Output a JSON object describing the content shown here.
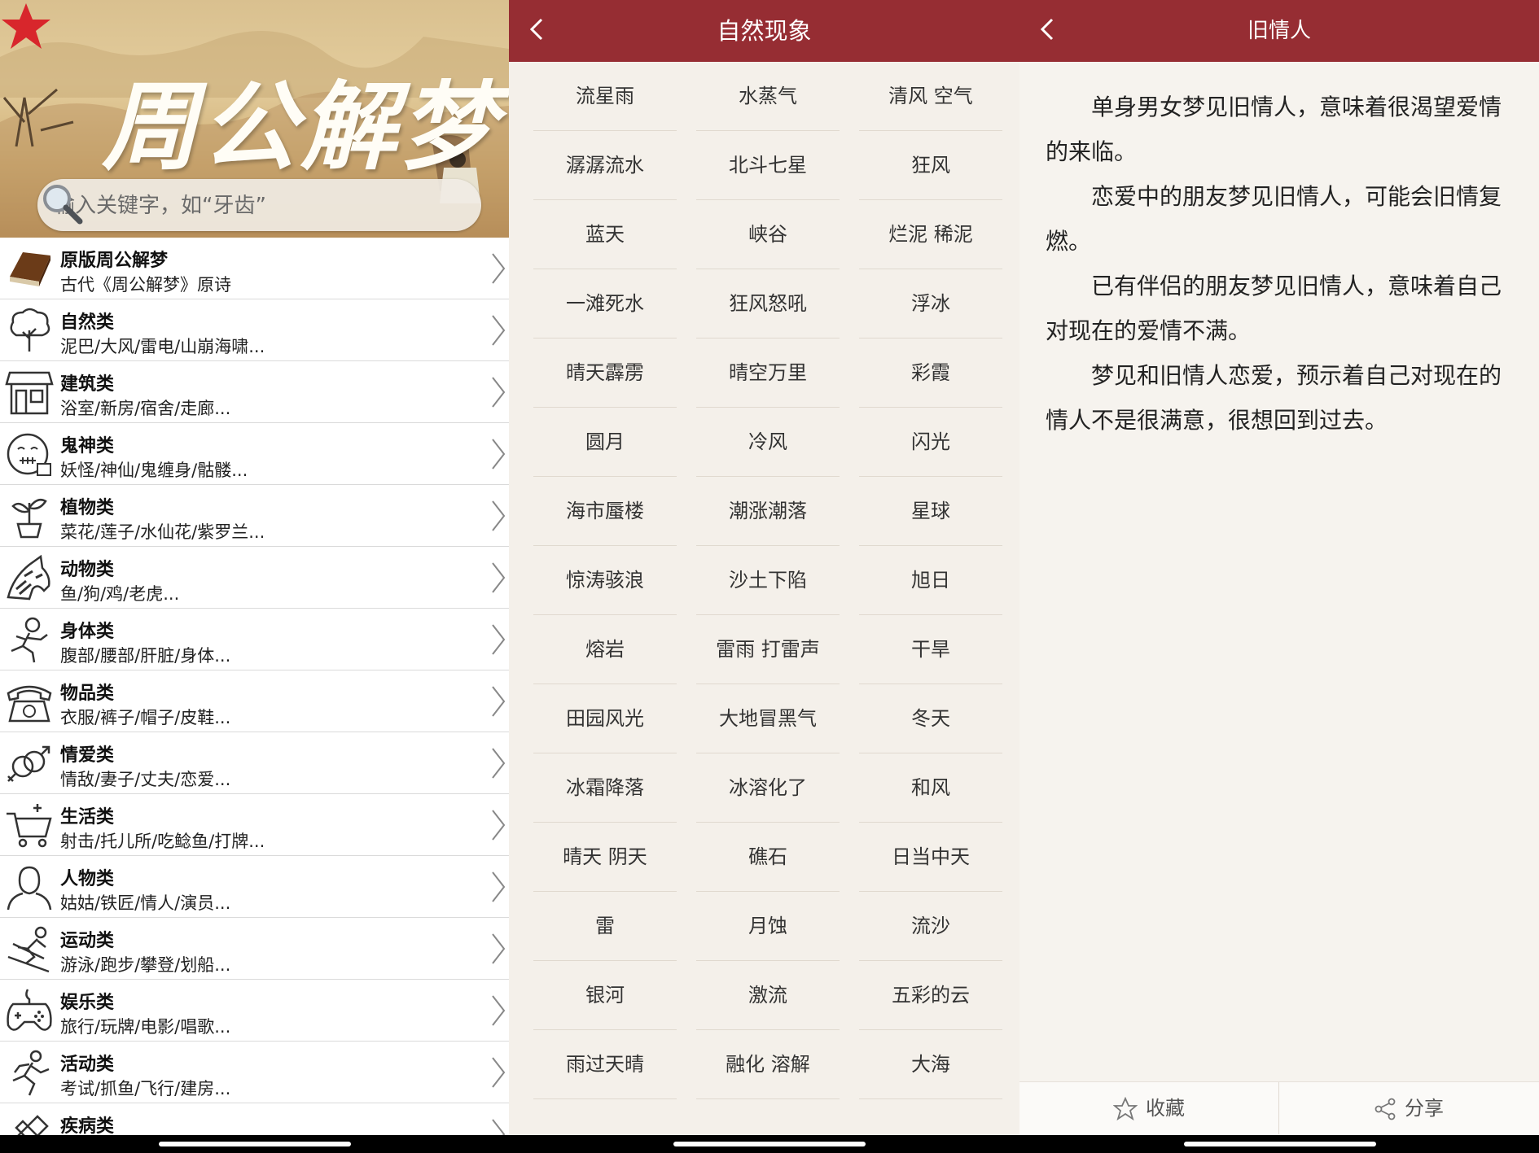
{
  "home": {
    "app_title": "周公解梦",
    "search_placeholder": "输入关键字，如“牙齿”",
    "categories": [
      {
        "name": "原版周公解梦",
        "sub": "古代《周公解梦》原诗",
        "icon": "book-icon"
      },
      {
        "name": "自然类",
        "sub": "泥巴/大风/雷电/山崩海啸...",
        "icon": "tree-icon"
      },
      {
        "name": "建筑类",
        "sub": "浴室/新房/宿舍/走廊...",
        "icon": "building-icon"
      },
      {
        "name": "鬼神类",
        "sub": "妖怪/神仙/鬼缠身/骷髅...",
        "icon": "ghost-face-icon"
      },
      {
        "name": "植物类",
        "sub": "菜花/莲子/水仙花/紫罗兰...",
        "icon": "plant-icon"
      },
      {
        "name": "动物类",
        "sub": "鱼/狗/鸡/老虎...",
        "icon": "zebra-icon"
      },
      {
        "name": "身体类",
        "sub": "腹部/腰部/肝脏/身体...",
        "icon": "running-body-icon"
      },
      {
        "name": "物品类",
        "sub": "衣服/裤子/帽子/皮鞋...",
        "icon": "telephone-icon"
      },
      {
        "name": "情爱类",
        "sub": "情敌/妻子/丈夫/恋爱...",
        "icon": "gender-icon"
      },
      {
        "name": "生活类",
        "sub": "射击/托儿所/吃鲶鱼/打牌...",
        "icon": "cart-icon"
      },
      {
        "name": "人物类",
        "sub": "姑姑/铁匠/情人/演员...",
        "icon": "person-icon"
      },
      {
        "name": "运动类",
        "sub": "游泳/跑步/攀登/划船...",
        "icon": "skier-icon"
      },
      {
        "name": "娱乐类",
        "sub": "旅行/玩牌/电影/唱歌...",
        "icon": "gamepad-icon"
      },
      {
        "name": "活动类",
        "sub": "考试/抓鱼/飞行/建房...",
        "icon": "runner-icon"
      },
      {
        "name": "疾病类",
        "sub": "",
        "icon": "bandage-icon"
      }
    ]
  },
  "list_view": {
    "title": "自然现象",
    "items": [
      [
        "流星雨",
        "水蒸气",
        "清风 空气"
      ],
      [
        "潺潺流水",
        "北斗七星",
        "狂风"
      ],
      [
        "蓝天",
        "峡谷",
        "烂泥 稀泥"
      ],
      [
        "一滩死水",
        "狂风怒吼",
        "浮冰"
      ],
      [
        "晴天霹雳",
        "晴空万里",
        "彩霞"
      ],
      [
        "圆月",
        "冷风",
        "闪光"
      ],
      [
        "海市蜃楼",
        "潮涨潮落",
        "星球"
      ],
      [
        "惊涛骇浪",
        "沙土下陷",
        "旭日"
      ],
      [
        "熔岩",
        "雷雨 打雷声",
        "干旱"
      ],
      [
        "田园风光",
        "大地冒黑气",
        "冬天"
      ],
      [
        "冰霜降落",
        "冰溶化了",
        "和风"
      ],
      [
        "晴天 阴天",
        "礁石",
        "日当中天"
      ],
      [
        "雷",
        "月蚀",
        "流沙"
      ],
      [
        "银河",
        "激流",
        "五彩的云"
      ],
      [
        "雨过天晴",
        "融化 溶解",
        "大海"
      ]
    ]
  },
  "detail_view": {
    "title": "旧情人",
    "paragraphs": [
      "单身男女梦见旧情人，意味着很渴望爱情的来临。",
      "恋爱中的朋友梦见旧情人，可能会旧情复燃。",
      "已有伴侣的朋友梦见旧情人，意味着自己对现在的爱情不满。",
      "梦见和旧情人恋爱，预示着自己对现在的情人不是很满意，很想回到过去。"
    ],
    "favorite_label": "收藏",
    "share_label": "分享"
  },
  "colors": {
    "titlebar": "#962d33",
    "star": "#d8262c"
  }
}
